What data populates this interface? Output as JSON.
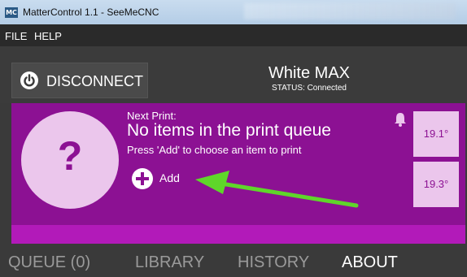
{
  "window": {
    "title": "MatterControl 1.1 - SeeMeCNC",
    "app_icon": "MC"
  },
  "menu": {
    "file": "FILE",
    "help": "HELP"
  },
  "topbar": {
    "disconnect_label": "DISCONNECT",
    "printer_name": "White MAX",
    "status": "STATUS: Connected"
  },
  "print_panel": {
    "thumb_glyph": "?",
    "next_label": "Next Print:",
    "title": "No items in the print queue",
    "subtitle": "Press 'Add' to choose an item to print",
    "add_label": "Add"
  },
  "temps": {
    "extruder": "19.1°",
    "bed": "19.3°"
  },
  "tabs": [
    {
      "label": "QUEUE (0)"
    },
    {
      "label": "LIBRARY"
    },
    {
      "label": "HISTORY"
    },
    {
      "label": "ABOUT"
    }
  ],
  "colors": {
    "accent": "#8c1193",
    "progress": "#b21ab9",
    "annotation_arrow": "#5fd62a"
  }
}
